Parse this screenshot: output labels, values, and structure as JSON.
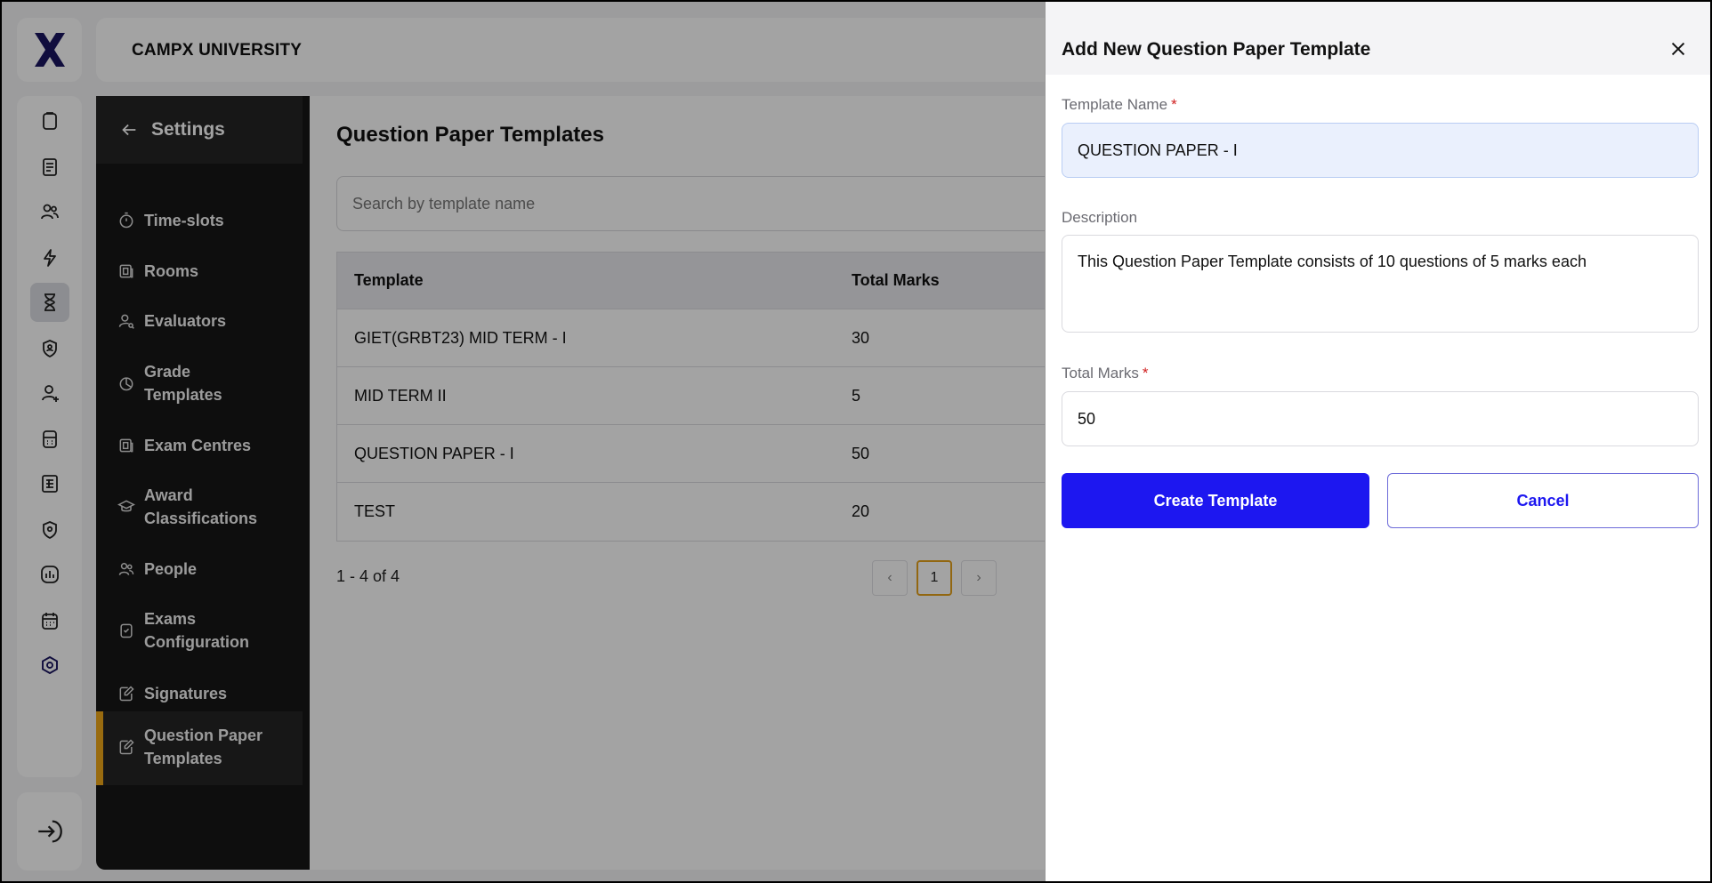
{
  "app": {
    "logo_icon": "campx-x-logo",
    "org_name": "CAMPX UNIVERSITY"
  },
  "rail": {
    "icons": [
      "clipboard-icon",
      "notebook-icon",
      "people-icon",
      "lightning-icon",
      "hourglass-icon",
      "shield-user-icon",
      "user-plus-icon",
      "calculator-icon",
      "spreadsheet-icon",
      "shield-location-icon",
      "chart-icon",
      "calendar-icon",
      "hexagon-settings-icon"
    ],
    "active_index": 4,
    "exit_icon": "logout-icon"
  },
  "settings": {
    "back_label": "Settings",
    "items": [
      {
        "label": "Time-slots",
        "icon": "stopwatch-icon"
      },
      {
        "label": "Rooms",
        "icon": "room-icon"
      },
      {
        "label": "Evaluators",
        "icon": "evaluator-icon"
      },
      {
        "label": "Grade Templates",
        "icon": "grade-icon"
      },
      {
        "label": "Exam Centres",
        "icon": "building-icon"
      },
      {
        "label": "Award Classifications",
        "icon": "graduation-cap-icon"
      },
      {
        "label": "People",
        "icon": "people-icon"
      },
      {
        "label": "Exams Configuration",
        "icon": "clipboard-check-icon"
      },
      {
        "label": "Signatures",
        "icon": "signature-icon"
      },
      {
        "label": "Question Paper Templates",
        "icon": "edit-doc-icon"
      }
    ],
    "active_index": 9
  },
  "main": {
    "page_title": "Question Paper Templates",
    "search_placeholder": "Search by template name",
    "table": {
      "headers": [
        "Template",
        "Total Marks"
      ],
      "rows": [
        [
          "GIET(GRBT23) MID TERM - I",
          "30"
        ],
        [
          "MID TERM II",
          "5"
        ],
        [
          "QUESTION PAPER - I",
          "50"
        ],
        [
          "TEST",
          "20"
        ]
      ]
    },
    "pagination": {
      "count_text": "1 - 4 of 4",
      "current_page": "1",
      "prev_symbol": "‹",
      "next_symbol": "›"
    }
  },
  "drawer": {
    "title": "Add New Question Paper Template",
    "close_icon": "close-icon",
    "template_name": {
      "label": "Template Name",
      "required_mark": "*",
      "value": "QUESTION PAPER - I"
    },
    "description": {
      "label": "Description",
      "value": "This Question Paper Template consists of 10 questions of 5 marks each"
    },
    "total_marks": {
      "label": "Total Marks",
      "required_mark": "*",
      "value": "50"
    },
    "create_label": "Create Template",
    "cancel_label": "Cancel"
  },
  "colors": {
    "primary": "#1d17f0",
    "active_accent": "#f0a818",
    "sidebar_bg": "#161616",
    "required": "#d02020"
  }
}
